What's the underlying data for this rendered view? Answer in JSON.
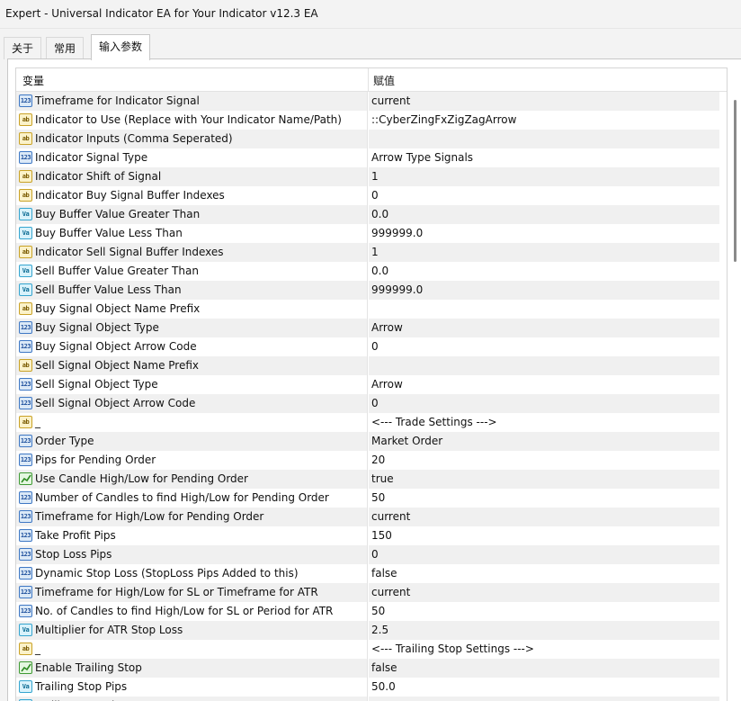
{
  "window": {
    "title": "Expert - Universal Indicator EA for Your Indicator v12.3 EA"
  },
  "tabs": [
    {
      "label": "关于",
      "active": false
    },
    {
      "label": "常用",
      "active": false
    },
    {
      "label": "输入参数",
      "active": true
    }
  ],
  "grid": {
    "columns": {
      "variable": "变量",
      "value": "赋值"
    },
    "rows": [
      {
        "type": "num",
        "icon": "integer-param-icon",
        "name": "Timeframe for Indicator Signal",
        "value": "current"
      },
      {
        "type": "str",
        "icon": "string-param-icon",
        "name": "Indicator to Use (Replace with Your Indicator Name/Path)",
        "value": "::CyberZingFxZigZagArrow"
      },
      {
        "type": "str",
        "icon": "string-param-icon",
        "name": "Indicator Inputs (Comma Seperated)",
        "value": ""
      },
      {
        "type": "num",
        "icon": "integer-param-icon",
        "name": "Indicator Signal Type",
        "value": "Arrow Type Signals"
      },
      {
        "type": "str",
        "icon": "string-param-icon",
        "name": "Indicator Shift of Signal",
        "value": "1"
      },
      {
        "type": "str",
        "icon": "string-param-icon",
        "name": "Indicator Buy Signal Buffer Indexes",
        "value": "0"
      },
      {
        "type": "dbl",
        "icon": "double-param-icon",
        "name": "Buy Buffer Value Greater Than",
        "value": "0.0"
      },
      {
        "type": "dbl",
        "icon": "double-param-icon",
        "name": "Buy Buffer Value Less Than",
        "value": "999999.0"
      },
      {
        "type": "str",
        "icon": "string-param-icon",
        "name": "Indicator Sell Signal Buffer Indexes",
        "value": "1"
      },
      {
        "type": "dbl",
        "icon": "double-param-icon",
        "name": "Sell Buffer Value Greater Than",
        "value": "0.0"
      },
      {
        "type": "dbl",
        "icon": "double-param-icon",
        "name": "Sell Buffer Value Less Than",
        "value": "999999.0"
      },
      {
        "type": "str",
        "icon": "string-param-icon",
        "name": "Buy Signal Object Name Prefix",
        "value": ""
      },
      {
        "type": "num",
        "icon": "integer-param-icon",
        "name": "Buy Signal Object Type",
        "value": "Arrow"
      },
      {
        "type": "num",
        "icon": "integer-param-icon",
        "name": "Buy Signal Object Arrow Code",
        "value": "0"
      },
      {
        "type": "str",
        "icon": "string-param-icon",
        "name": "Sell Signal Object Name Prefix",
        "value": ""
      },
      {
        "type": "num",
        "icon": "integer-param-icon",
        "name": "Sell Signal Object Type",
        "value": "Arrow"
      },
      {
        "type": "num",
        "icon": "integer-param-icon",
        "name": "Sell Signal Object Arrow Code",
        "value": "0"
      },
      {
        "type": "str",
        "icon": "string-param-icon",
        "name": "_",
        "value": "<--- Trade Settings --->"
      },
      {
        "type": "num",
        "icon": "integer-param-icon",
        "name": "Order Type",
        "value": "Market Order"
      },
      {
        "type": "num",
        "icon": "integer-param-icon",
        "name": "Pips for Pending Order",
        "value": "20"
      },
      {
        "type": "bool",
        "icon": "bool-param-icon",
        "name": "Use Candle High/Low for Pending Order",
        "value": "true"
      },
      {
        "type": "num",
        "icon": "integer-param-icon",
        "name": "Number of Candles to find High/Low for Pending Order",
        "value": "50"
      },
      {
        "type": "num",
        "icon": "integer-param-icon",
        "name": "Timeframe for High/Low for Pending Order",
        "value": "current"
      },
      {
        "type": "num",
        "icon": "integer-param-icon",
        "name": "Take Profit Pips",
        "value": "150"
      },
      {
        "type": "num",
        "icon": "integer-param-icon",
        "name": "Stop Loss Pips",
        "value": "0"
      },
      {
        "type": "num",
        "icon": "integer-param-icon",
        "name": "Dynamic Stop Loss (StopLoss Pips Added to this)",
        "value": "false"
      },
      {
        "type": "num",
        "icon": "integer-param-icon",
        "name": "Timeframe for High/Low for SL or Timeframe for ATR",
        "value": "current"
      },
      {
        "type": "num",
        "icon": "integer-param-icon",
        "name": "No. of Candles to find High/Low for SL or Period for ATR",
        "value": "50"
      },
      {
        "type": "dbl",
        "icon": "double-param-icon",
        "name": "Multiplier for ATR Stop Loss",
        "value": "2.5"
      },
      {
        "type": "str",
        "icon": "string-param-icon",
        "name": "_",
        "value": "<--- Trailing Stop Settings --->"
      },
      {
        "type": "bool",
        "icon": "bool-param-icon",
        "name": "Enable Trailing Stop",
        "value": "false"
      },
      {
        "type": "dbl",
        "icon": "double-param-icon",
        "name": "Trailing Stop Pips",
        "value": "50.0"
      },
      {
        "type": "dbl",
        "icon": "double-param-icon",
        "name": "Trailing Step Pips",
        "value": ""
      }
    ]
  },
  "icon_text": {
    "num": "123",
    "str": "ab",
    "dbl": "Va"
  }
}
